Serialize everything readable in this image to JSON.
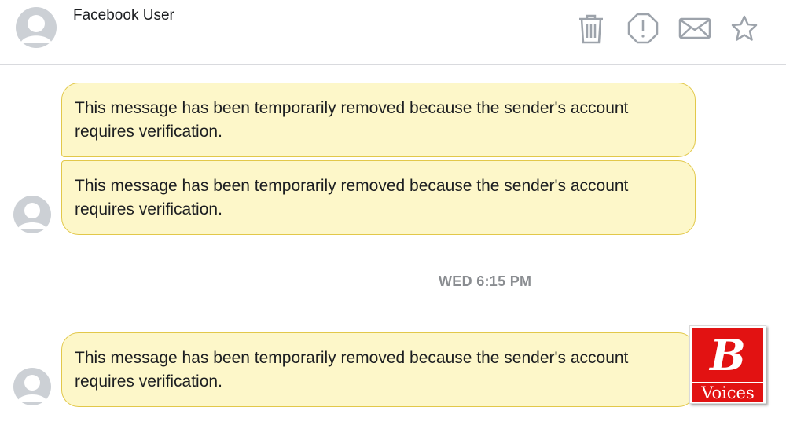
{
  "header": {
    "contact_name": "Facebook User",
    "actions": [
      "trash-icon",
      "report-icon",
      "mail-icon",
      "star-icon"
    ]
  },
  "messages": [
    {
      "text": "This message has been temporarily removed because the sender's account requires verification."
    },
    {
      "text": "This message has been temporarily removed because the sender's account requires verification."
    },
    {
      "text": "This message has been temporarily removed because the sender's account requires verification."
    }
  ],
  "timestamp": "WED 6:15 PM",
  "watermark": {
    "letter": "B",
    "caption": "Voices"
  },
  "colors": {
    "bubble_bg": "#fdf7c9",
    "bubble_border": "#e2c84a",
    "icon_gray": "#9da3ab",
    "avatar_gray": "#ccd0d5",
    "watermark_red": "#e21212"
  }
}
